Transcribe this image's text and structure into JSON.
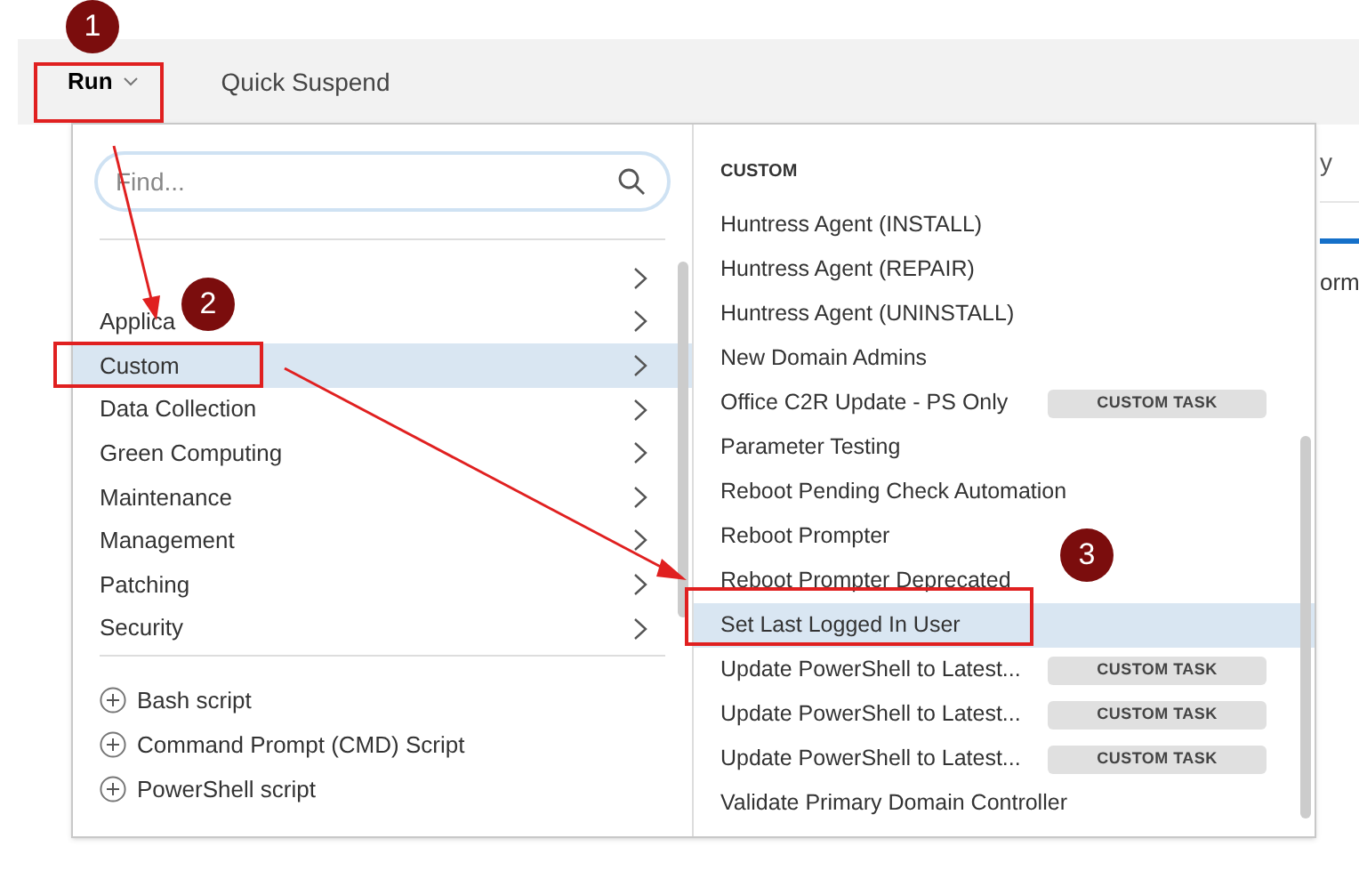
{
  "toolbar": {
    "run_button": {
      "label": "Run",
      "expanded": true
    },
    "quick_suspend": "Quick Suspend"
  },
  "background": {
    "tab_fragment": "y",
    "heading_fragment": "orm"
  },
  "menu": {
    "search": {
      "placeholder": "Find..."
    },
    "categories": [
      {
        "selected": false
      },
      {
        "label": "Applica",
        "selected": false
      },
      {
        "label": "Custom",
        "selected": true
      },
      {
        "label": "Data Collection",
        "selected": false
      },
      {
        "label": "Green Computing",
        "selected": false
      },
      {
        "label": "Maintenance",
        "selected": false
      },
      {
        "label": "Management",
        "selected": false
      },
      {
        "label": "Patching",
        "selected": false
      },
      {
        "label": "Security",
        "selected": false
      }
    ],
    "new_scripts": [
      "Bash script",
      "Command Prompt (CMD) Script",
      "PowerShell script"
    ],
    "section_title": "CUSTOM",
    "tasks": [
      {
        "label": "Huntress Agent (INSTALL)",
        "selected": false
      },
      {
        "label": "Huntress Agent (REPAIR)",
        "selected": false
      },
      {
        "label": "Huntress Agent (UNINSTALL)",
        "selected": false
      },
      {
        "label": "New Domain Admins",
        "selected": false
      },
      {
        "label": "Office C2R Update - PS Only",
        "badge": "CUSTOM TASK",
        "selected": false
      },
      {
        "label": "Parameter Testing",
        "selected": false
      },
      {
        "label": "Reboot Pending Check Automation",
        "selected": false
      },
      {
        "label": "Reboot Prompter",
        "selected": false
      },
      {
        "label": "Reboot Prompter Deprecated",
        "selected": false
      },
      {
        "label": "Set Last Logged In User",
        "selected": true
      },
      {
        "label": "Update PowerShell to Latest...",
        "badge": "CUSTOM TASK",
        "selected": false
      },
      {
        "label": "Update PowerShell to Latest...",
        "badge": "CUSTOM TASK",
        "selected": false
      },
      {
        "label": "Update PowerShell to Latest...",
        "badge": "CUSTOM TASK",
        "selected": false
      },
      {
        "label": "Validate Primary Domain Controller",
        "selected": false
      }
    ]
  },
  "annotations": [
    {
      "label": "1"
    },
    {
      "label": "2"
    },
    {
      "label": "3"
    }
  ]
}
